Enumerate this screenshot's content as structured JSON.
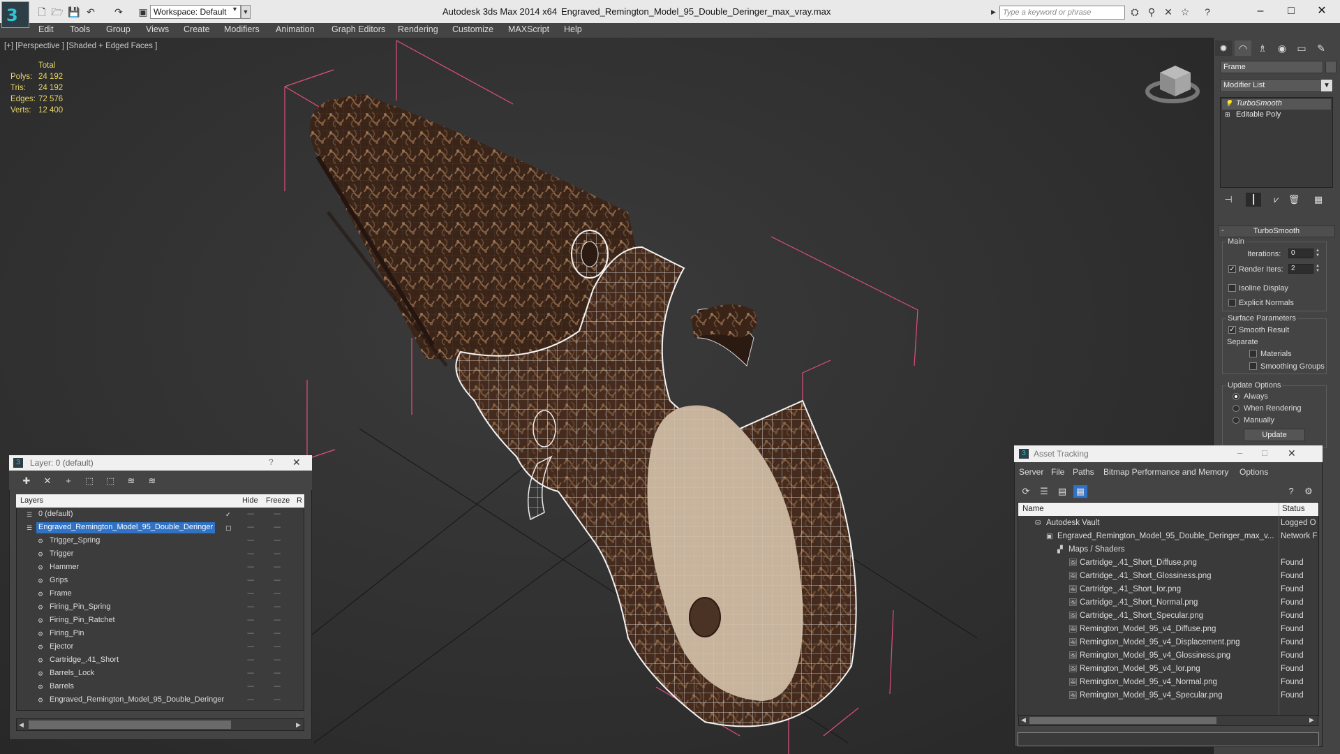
{
  "title_bar": {
    "app_title": "Autodesk 3ds Max  2014 x64",
    "file_title": "Engraved_Remington_Model_95_Double_Deringer_max_vray.max",
    "workspace": "Workspace: Default",
    "search_placeholder": "Type a keyword or phrase",
    "window_controls": [
      "–",
      "□",
      "✕"
    ]
  },
  "menu": [
    "Edit",
    "Tools",
    "Group",
    "Views",
    "Create",
    "Modifiers",
    "Animation",
    "Graph Editors",
    "Rendering",
    "Customize",
    "MAXScript",
    "Help"
  ],
  "viewport": {
    "label": "[+] [Perspective ] [Shaded + Edged Faces ]",
    "stats_header": "Total",
    "stats": [
      {
        "label": "Polys:",
        "value": "24 192"
      },
      {
        "label": "Tris:",
        "value": "24 192"
      },
      {
        "label": "Edges:",
        "value": "72 576"
      },
      {
        "label": "Verts:",
        "value": "12 400"
      }
    ]
  },
  "command_panel": {
    "object_name": "Frame",
    "modifier_list": "Modifier List",
    "stack": [
      "TurboSmooth",
      "Editable Poly"
    ],
    "rollout": {
      "title": "TurboSmooth",
      "main_label": "Main",
      "iterations_label": "Iterations:",
      "iterations_value": "0",
      "render_iters_label": "Render Iters:",
      "render_iters_value": "2",
      "render_iters_checked": true,
      "isoline_label": "Isoline Display",
      "explicit_label": "Explicit Normals",
      "surface_label": "Surface Parameters",
      "smooth_result_label": "Smooth Result",
      "separate_label": "Separate",
      "materials_label": "Materials",
      "smoothing_groups_label": "Smoothing Groups",
      "update_options_label": "Update Options",
      "always_label": "Always",
      "when_rendering_label": "When Rendering",
      "manually_label": "Manually",
      "update_button": "Update"
    }
  },
  "layer_dialog": {
    "title": "Layer: 0 (default)",
    "help": "?",
    "close": "✕",
    "columns": [
      "Layers",
      "Hide",
      "Freeze",
      "R"
    ],
    "rows": [
      {
        "name": "0 (default)",
        "indent": 0,
        "selected": false,
        "checked": true
      },
      {
        "name": "Engraved_Remington_Model_95_Double_Deringer",
        "indent": 0,
        "selected": true,
        "checked": false
      },
      {
        "name": "Trigger_Spring",
        "indent": 1
      },
      {
        "name": "Trigger",
        "indent": 1
      },
      {
        "name": "Hammer",
        "indent": 1
      },
      {
        "name": "Grips",
        "indent": 1
      },
      {
        "name": "Frame",
        "indent": 1
      },
      {
        "name": "Firing_Pin_Spring",
        "indent": 1
      },
      {
        "name": "Firing_Pin_Ratchet",
        "indent": 1
      },
      {
        "name": "Firing_Pin",
        "indent": 1
      },
      {
        "name": "Ejector",
        "indent": 1
      },
      {
        "name": "Cartridge_.41_Short",
        "indent": 1
      },
      {
        "name": "Barrels_Lock",
        "indent": 1
      },
      {
        "name": "Barrels",
        "indent": 1
      },
      {
        "name": "Engraved_Remington_Model_95_Double_Deringer",
        "indent": 1
      }
    ]
  },
  "asset_dialog": {
    "title": "Asset Tracking",
    "menu": [
      "Server",
      "File",
      "Paths",
      "Bitmap Performance and Memory",
      "Options"
    ],
    "columns": [
      "Name",
      "Status"
    ],
    "rows": [
      {
        "name": "Autodesk Vault",
        "status": "Logged O",
        "indent": 0
      },
      {
        "name": "Engraved_Remington_Model_95_Double_Deringer_max_v...",
        "status": "Network F",
        "indent": 1
      },
      {
        "name": "Maps / Shaders",
        "status": "",
        "indent": 2
      },
      {
        "name": "Cartridge_.41_Short_Diffuse.png",
        "status": "Found",
        "indent": 3
      },
      {
        "name": "Cartridge_.41_Short_Glossiness.png",
        "status": "Found",
        "indent": 3
      },
      {
        "name": "Cartridge_.41_Short_Ior.png",
        "status": "Found",
        "indent": 3
      },
      {
        "name": "Cartridge_.41_Short_Normal.png",
        "status": "Found",
        "indent": 3
      },
      {
        "name": "Cartridge_.41_Short_Specular.png",
        "status": "Found",
        "indent": 3
      },
      {
        "name": "Remington_Model_95_v4_Diffuse.png",
        "status": "Found",
        "indent": 3
      },
      {
        "name": "Remington_Model_95_v4_Displacement.png",
        "status": "Found",
        "indent": 3
      },
      {
        "name": "Remington_Model_95_v4_Glossiness.png",
        "status": "Found",
        "indent": 3
      },
      {
        "name": "Remington_Model_95_v4_Ior.png",
        "status": "Found",
        "indent": 3
      },
      {
        "name": "Remington_Model_95_v4_Normal.png",
        "status": "Found",
        "indent": 3
      },
      {
        "name": "Remington_Model_95_v4_Specular.png",
        "status": "Found",
        "indent": 3
      }
    ]
  },
  "colors": {
    "selection": "#2f72c6",
    "stats": "#e6d46a",
    "bbox": "#e0507a"
  }
}
